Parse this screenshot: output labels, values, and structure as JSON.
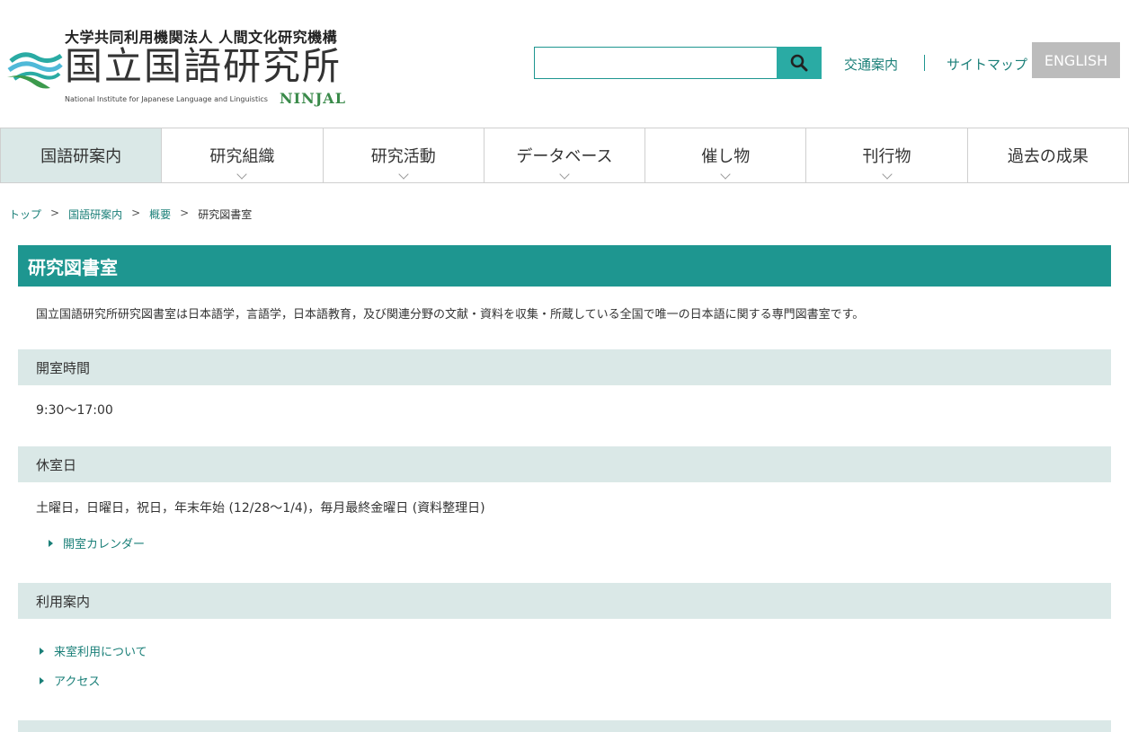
{
  "header": {
    "org_name": "大学共同利用機関法人 人間文化研究機構",
    "site_name": "国立国語研究所",
    "site_name_en": "National Institute for Japanese Language and Linguistics",
    "abbr": "NINJAL",
    "search_placeholder": "",
    "search_icon": "search-icon",
    "links": {
      "access": "交通案内",
      "sitemap": "サイトマップ",
      "english": "ENGLISH"
    }
  },
  "gnav": {
    "items": [
      {
        "label": "国語研案内",
        "active": true
      },
      {
        "label": "研究組織",
        "has_submenu": true
      },
      {
        "label": "研究活動",
        "has_submenu": true
      },
      {
        "label": "データベース",
        "has_submenu": true
      },
      {
        "label": "催し物",
        "has_submenu": true
      },
      {
        "label": "刊行物",
        "has_submenu": true
      },
      {
        "label": "過去の成果"
      }
    ]
  },
  "breadcrumb": {
    "items": [
      "トップ",
      "国語研案内",
      "概要"
    ],
    "current": "研究図書室",
    "separator": ">"
  },
  "main": {
    "title": "研究図書室",
    "intro": "国立国語研究所研究図書室は日本語学，言語学，日本語教育，及び関連分野の文献・資料を収集・所蔵している全国で唯一の日本語に関する専門図書室です。",
    "hours": {
      "heading": "開室時間",
      "text": "9:30～17:00"
    },
    "closed": {
      "heading": "休室日",
      "text": "土曜日，日曜日，祝日，年末年始 (12/28～1/4)，毎月最終金曜日 (資料整理日)",
      "link": "開室カレンダー"
    },
    "usage": {
      "heading": "利用案内",
      "links": [
        "来室利用について",
        "アクセス"
      ]
    }
  },
  "colors": {
    "primary": "#1e9690",
    "link": "#1a7f78",
    "section_bg": "#dae8e7",
    "english_bg": "#bcbcbc"
  }
}
